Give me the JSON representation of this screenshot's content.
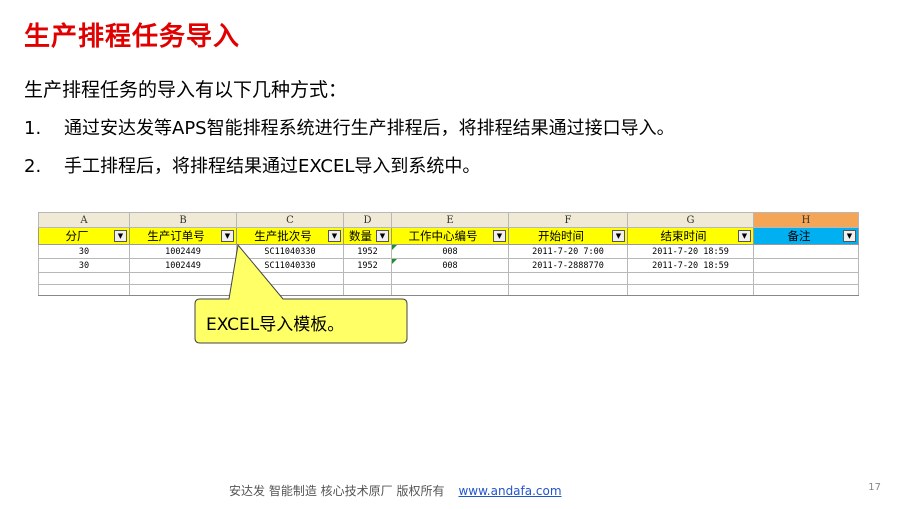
{
  "title": "生产排程任务导入",
  "intro": "生产排程任务的导入有以下几种方式：",
  "items": [
    {
      "num": "1.",
      "text": "通过安达发等APS智能排程系统进行生产排程后，将排程结果通过接口导入。"
    },
    {
      "num": "2.",
      "text": "手工排程后，将排程结果通过EXCEL导入到系统中。"
    }
  ],
  "sheet": {
    "column_letters": [
      "A",
      "B",
      "C",
      "D",
      "E",
      "F",
      "G",
      "H"
    ],
    "headers": [
      "分厂",
      "生产订单号",
      "生产批次号",
      "数量",
      "工作中心编号",
      "开始时间",
      "结束时间",
      "备注"
    ],
    "rows": [
      [
        "30",
        "1002449",
        "SC11040330",
        "1952",
        "008",
        "2011-7-20  7:00",
        "2011-7-20  18:59",
        ""
      ],
      [
        "30",
        "1002449",
        "SC11040330",
        "1952",
        "008",
        "2011-7-2888770",
        "2011-7-20  18:59",
        ""
      ]
    ],
    "dropdown_glyph": "▼"
  },
  "callout": "EXCEL导入模板。",
  "footer": {
    "text": "安达发   智能制造 核心技术原厂    版权所有",
    "link": "www.andafa.com"
  },
  "page_number": "17"
}
